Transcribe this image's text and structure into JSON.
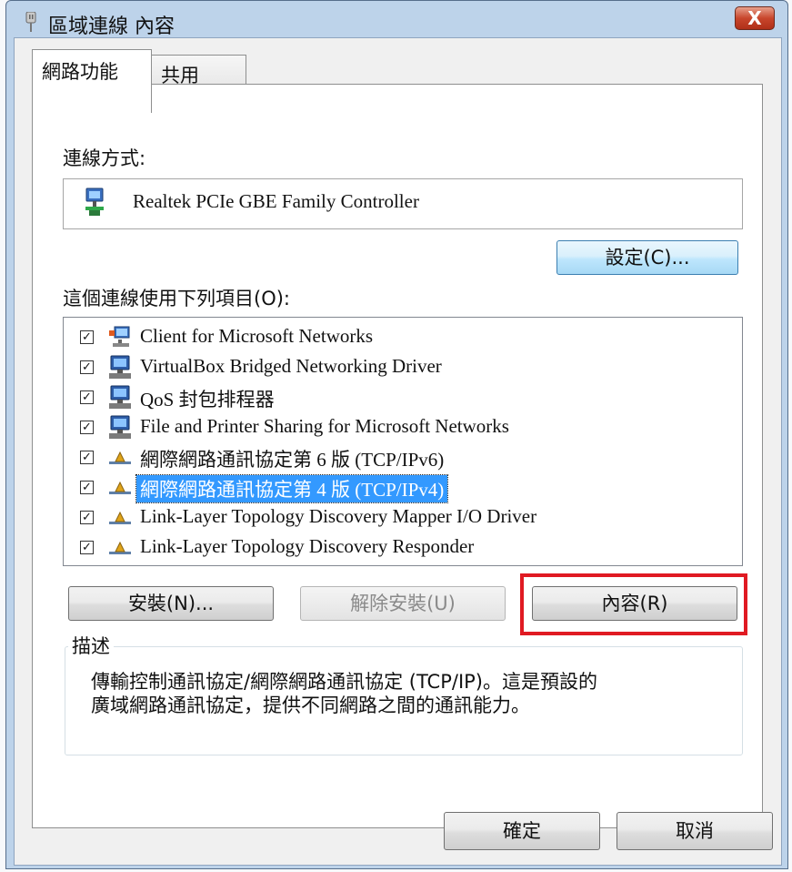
{
  "window": {
    "title": "區域連線 內容",
    "close_label": "X"
  },
  "tabs": [
    {
      "label": "網路功能",
      "active": true
    },
    {
      "label": "共用",
      "active": false
    }
  ],
  "connect_using": {
    "label": "連線方式:",
    "adapter": "Realtek PCIe GBE Family Controller",
    "configure_button": "設定(C)..."
  },
  "items_section": {
    "label": "這個連線使用下列項目(O):",
    "items": [
      {
        "label": "Client for Microsoft Networks",
        "checked": true,
        "icon": "network-client-icon"
      },
      {
        "label": "VirtualBox Bridged Networking Driver",
        "checked": true,
        "icon": "network-service-icon"
      },
      {
        "label": "QoS 封包排程器",
        "checked": true,
        "icon": "network-service-icon"
      },
      {
        "label": "File and Printer Sharing for Microsoft Networks",
        "checked": true,
        "icon": "network-service-icon"
      },
      {
        "label": "網際網路通訊協定第 6 版 (TCP/IPv6)",
        "checked": true,
        "icon": "protocol-icon"
      },
      {
        "label": "網際網路通訊協定第 4 版 (TCP/IPv4)",
        "checked": true,
        "icon": "protocol-icon",
        "selected": true
      },
      {
        "label": "Link-Layer Topology Discovery Mapper I/O Driver",
        "checked": true,
        "icon": "protocol-icon"
      },
      {
        "label": "Link-Layer Topology Discovery Responder",
        "checked": true,
        "icon": "protocol-icon"
      }
    ]
  },
  "actions": {
    "install": "安裝(N)...",
    "uninstall": "解除安裝(U)",
    "properties": "內容(R)"
  },
  "description": {
    "legend": "描述",
    "text_line1": "傳輸控制通訊協定/網際網路通訊協定 (TCP/IP)。這是預設的",
    "text_line2": "廣域網路通訊協定，提供不同網路之間的通訊能力。"
  },
  "footer": {
    "ok": "確定",
    "cancel": "取消"
  },
  "colors": {
    "selection": "#3399ff",
    "highlight_box": "#e01a22",
    "window_frame": "#bdd3ea"
  }
}
